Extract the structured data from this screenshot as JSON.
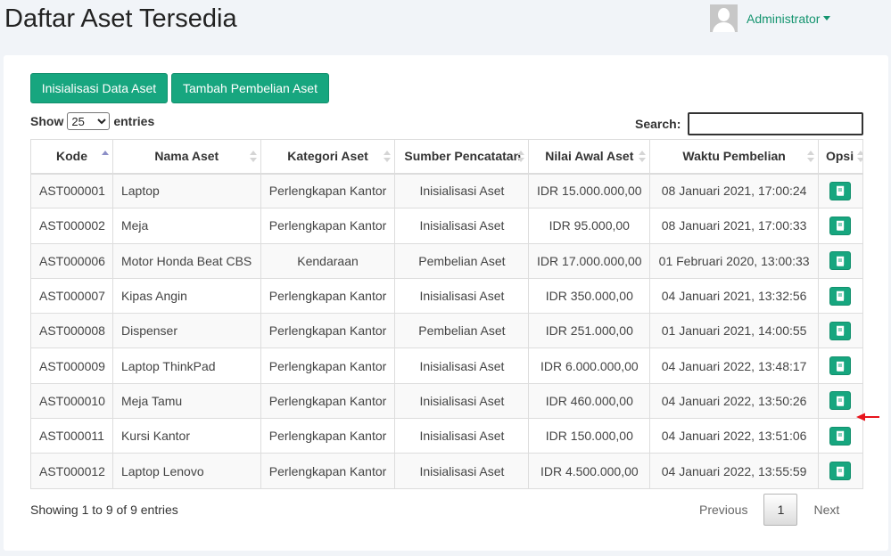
{
  "header": {
    "title": "Daftar Aset Tersedia",
    "user_name": "Administrator"
  },
  "toolbar": {
    "init_label": "Inisialisasi Data Aset",
    "add_label": "Tambah Pembelian Aset"
  },
  "length_menu": {
    "prefix": "Show",
    "selected": "25",
    "suffix": "entries"
  },
  "search": {
    "label": "Search:",
    "value": ""
  },
  "table": {
    "columns": [
      "Kode",
      "Nama Aset",
      "Kategori Aset",
      "Sumber Pencatatan",
      "Nilai Awal Aset",
      "Waktu Pembelian",
      "Opsi"
    ],
    "sorted_column": "Kode",
    "rows": [
      [
        "AST000001",
        "Laptop",
        "Perlengkapan Kantor",
        "Inisialisasi Aset",
        "IDR 15.000.000,00",
        "08 Januari 2021, 17:00:24"
      ],
      [
        "AST000002",
        "Meja",
        "Perlengkapan Kantor",
        "Inisialisasi Aset",
        "IDR 95.000,00",
        "08 Januari 2021, 17:00:33"
      ],
      [
        "AST000006",
        "Motor Honda Beat CBS",
        "Kendaraan",
        "Pembelian Aset",
        "IDR 17.000.000,00",
        "01 Februari 2020, 13:00:33"
      ],
      [
        "AST000007",
        "Kipas Angin",
        "Perlengkapan Kantor",
        "Inisialisasi Aset",
        "IDR 350.000,00",
        "04 Januari 2021, 13:32:56"
      ],
      [
        "AST000008",
        "Dispenser",
        "Perlengkapan Kantor",
        "Pembelian Aset",
        "IDR 251.000,00",
        "01 Januari 2021, 14:00:55"
      ],
      [
        "AST000009",
        "Laptop ThinkPad",
        "Perlengkapan Kantor",
        "Inisialisasi Aset",
        "IDR 6.000.000,00",
        "04 Januari 2022, 13:48:17"
      ],
      [
        "AST000010",
        "Meja Tamu",
        "Perlengkapan Kantor",
        "Inisialisasi Aset",
        "IDR 460.000,00",
        "04 Januari 2022, 13:50:26"
      ],
      [
        "AST000011",
        "Kursi Kantor",
        "Perlengkapan Kantor",
        "Inisialisasi Aset",
        "IDR 150.000,00",
        "04 Januari 2022, 13:51:06"
      ],
      [
        "AST000012",
        "Laptop Lenovo",
        "Perlengkapan Kantor",
        "Inisialisasi Aset",
        "IDR 4.500.000,00",
        "04 Januari 2022, 13:55:59"
      ]
    ]
  },
  "footer": {
    "info": "Showing 1 to 9 of 9 entries",
    "previous": "Previous",
    "page": "1",
    "next": "Next"
  },
  "icons": {
    "avatar": "user-avatar-icon",
    "option": "book-icon",
    "annotation": "red-arrow-icon"
  },
  "colors": {
    "accent": "#17a67f",
    "link": "#14946f",
    "annotation": "#e8141c"
  }
}
